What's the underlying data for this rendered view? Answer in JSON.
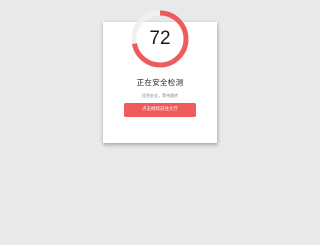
{
  "scan": {
    "score": "72",
    "progress": 0.72,
    "title": "正在安全检测",
    "status": "信息安全，等待跳转",
    "button_label": "点击继续前往大厅"
  },
  "colors": {
    "background": "#e7e9eb",
    "accent": "#ef5a5b",
    "track": "#f0f0f0"
  }
}
